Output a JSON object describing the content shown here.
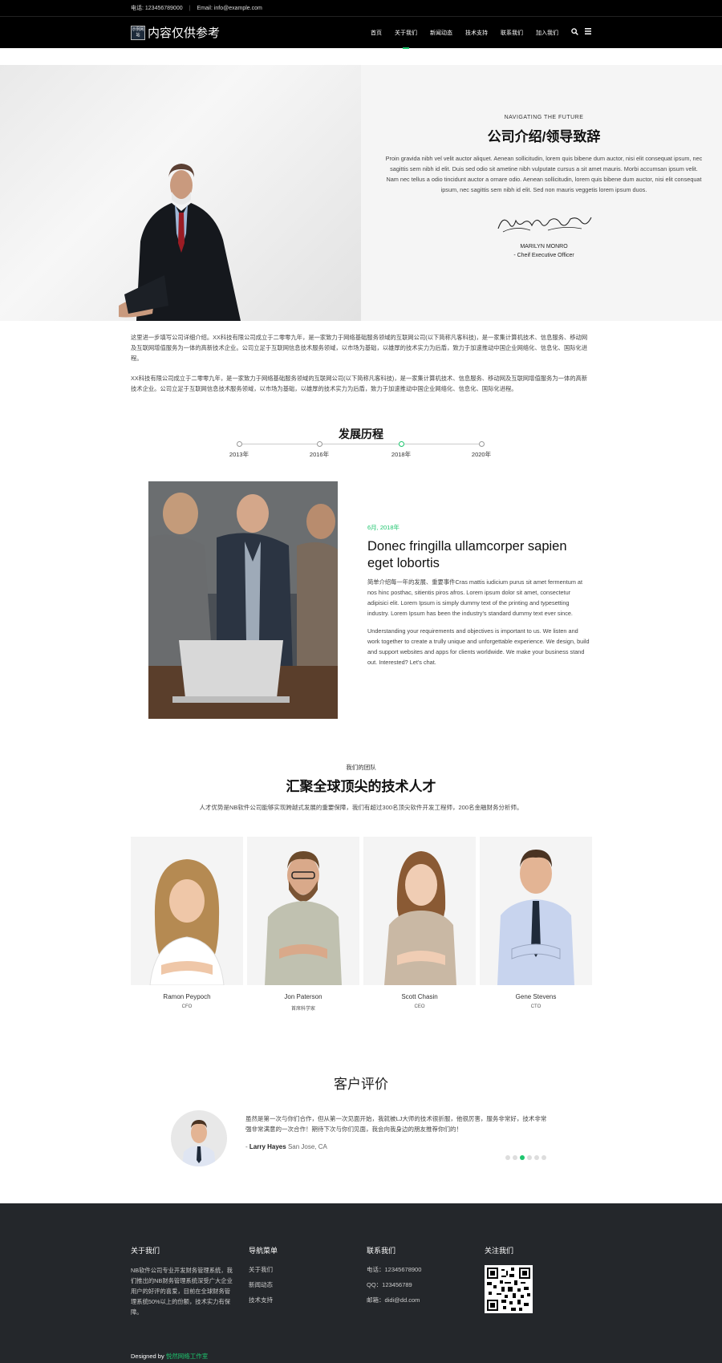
{
  "topbar": {
    "phone": "电话: 123456789000",
    "divider": "|",
    "email": "Email: info@example.com"
  },
  "header": {
    "logo_mark": "示例网站",
    "logo_text": "内容仅供参考",
    "nav": [
      "首页",
      "关于我们",
      "新闻动态",
      "技术支持",
      "联系我们",
      "加入我们"
    ],
    "active_nav": "关于我们",
    "icons": [
      "search-icon",
      "menu-icon"
    ]
  },
  "hero": {
    "kicker": "NAVIGATING THE FUTURE",
    "title": "公司介绍/领导致辞",
    "text": "Proin gravida nibh vel velit auctor aliquet. Aenean sollicitudin, lorem quis bibene dum auctor, nisi elit consequat ipsum, nec sagittis sem nibh id elit. Duis sed odio sit ametine nibh vulputate cursus a sit amet mauris. Morbi accumsan ipsum velit. Nam nec tellus a odio tincidunt auctor a ornare odio. Aenean sollicitudin, lorem quis bibene dum auctor, nisi elit consequat ipsum, nec sagittis sem nibh id elit. Sed non mauris veggetis lorem ipsum duos.",
    "name": "MARILYN MONRO",
    "role": "- Cheif Executive Officer"
  },
  "intro": {
    "p1": "这里进一步填写公司详细介绍。XX科技有限公司成立于二零零九年，是一家致力于网络基础服务领域的互联网公司(以下简称凡客科技)，是一家集计算机技术、信息服务、移动网及互联网增值服务为一体的高新技术企业。公司立足于互联网信息技术服务领域，以市场为基础，以雄厚的技术实力为后盾，致力于加速推动中国企业网络化、信息化、国际化进程。",
    "p2": "XX科技有限公司成立于二零零九年，是一家致力于网络基础服务领域的互联网公司(以下简称凡客科技)，是一家集计算机技术、信息服务、移动网及互联网增值服务为一体的高新技术企业。公司立足于互联网信息技术服务领域，以市场为基础，以雄厚的技术实力为后盾，致力于加速推动中国企业网络化、信息化、国际化进程。"
  },
  "history": {
    "title": "发展历程",
    "years": [
      "2013年",
      "2016年",
      "2018年",
      "2020年"
    ],
    "active_year": "2018年"
  },
  "story": {
    "date": "6月, 2018年",
    "title": "Donec fringilla ullamcorper sapien eget lobortis",
    "p1": "简单介绍每一年的发展、重要事件Cras mattis iudicium purus sit amet fermentum at nos hinc posthac, sitientis piros afros. Lorem ipsum dolor sit amet, consectetur adipisici elit. Lorem Ipsum is simply dummy text of the printing and typesetting industry. Lorem Ipsum has been the industry's standard dummy text ever since.",
    "p2": "Understanding your requirements and objectives is important to us. We listen and work together to create a trully unique and unforgettable experience. We design, build and support websites and apps for clients worldwide. We make your business stand out. Interested? Let's chat."
  },
  "team": {
    "kicker": "我们的团队",
    "title": "汇聚全球顶尖的技术人才",
    "desc": "人才优势是NB软件公司能够实现跨越式发展的重要保障，我们有超过300名顶尖软件开发工程师，200名金融财务分析师。",
    "members": [
      {
        "name": "Ramon Peypoch",
        "role": "CFO"
      },
      {
        "name": "Jon Paterson",
        "role": "首席科学家"
      },
      {
        "name": "Scott Chasin",
        "role": "CEO"
      },
      {
        "name": "Gene Stevens",
        "role": "CTO"
      }
    ]
  },
  "reviews": {
    "title": "客户评价",
    "text": "虽然是第一次与你们合作，但从第一次见面开始，我就被LJ大师的技术很折服，他很厉害，服务非常好，技术非常强非常满意的一次合作！期待下次与你们见面，我会向我身边的朋友推荐你们的！",
    "author_prefix": "- ",
    "author": "Larry Hayes",
    "location": "San Jose, CA",
    "dot_count": 6,
    "active_dot": 3
  },
  "footer": {
    "about_title": "关于我们",
    "about_text": "NB软件公司专业开发财务管理系统，我们推出的NB财务管理系统深受广大企业用户的好评的喜爱，目前在全球财务管理系统50%以上的份额，技术实力有保障。",
    "nav_title": "导航菜单",
    "nav_links": [
      "关于我们",
      "新闻动态",
      "技术支持"
    ],
    "contact_title": "联系我们",
    "contact": [
      "电话：12345678900",
      "QQ：123456789",
      "邮箱：didi@dd.com"
    ],
    "follow_title": "关注我们",
    "credit_prefix": "Designed by ",
    "credit_link": "悦然网络工作室"
  },
  "colors": {
    "accent": "#1ec56e",
    "footer_bg": "#24272b",
    "header_bg": "#000000"
  }
}
